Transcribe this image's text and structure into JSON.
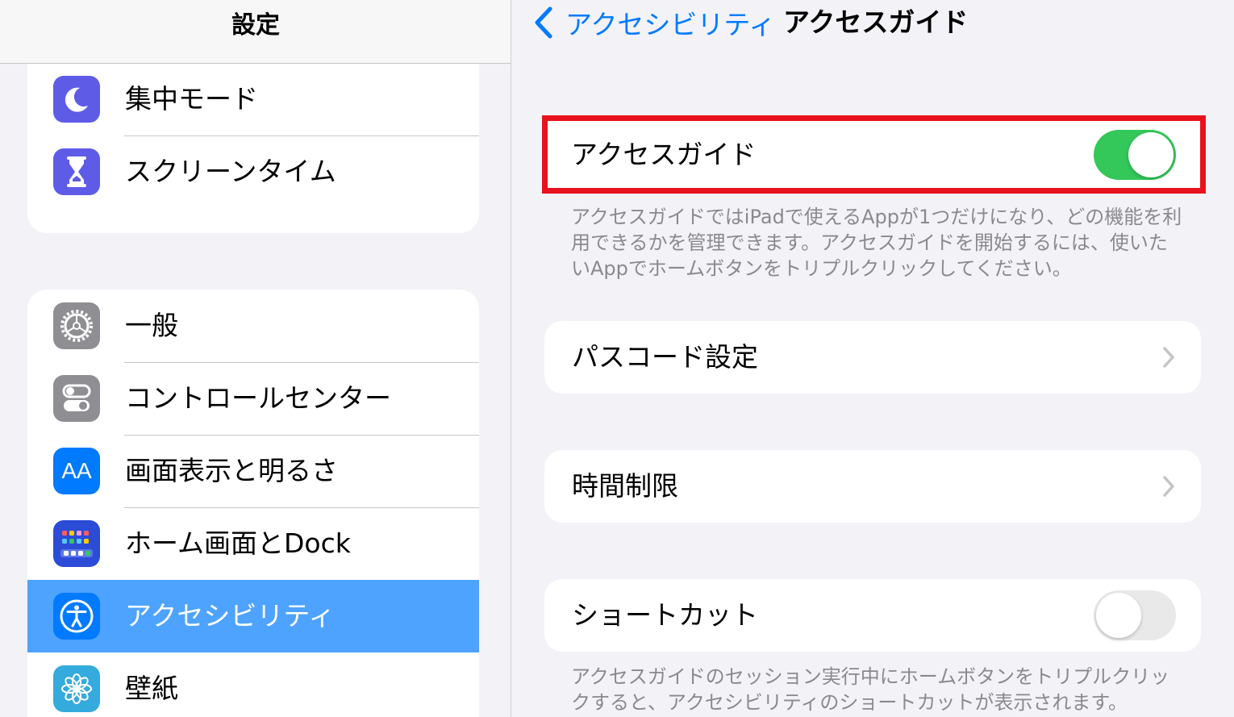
{
  "sidebar": {
    "title": "設定",
    "group1": [
      {
        "label": "集中モード",
        "icon": "moon-icon",
        "color": "#5e5ce6"
      },
      {
        "label": "スクリーンタイム",
        "icon": "hourglass-icon",
        "color": "#5e5ce6"
      }
    ],
    "group2": [
      {
        "label": "一般",
        "icon": "gear-icon",
        "color": "#8e8e93"
      },
      {
        "label": "コントロールセンター",
        "icon": "switches-icon",
        "color": "#8e8e93"
      },
      {
        "label": "画面表示と明るさ",
        "icon": "text-size-icon",
        "glyph": "AA",
        "color": "#007aff"
      },
      {
        "label": "ホーム画面とDock",
        "icon": "home-grid-icon",
        "color": "#2c4bd6"
      },
      {
        "label": "アクセシビリティ",
        "icon": "accessibility-icon",
        "color": "#007aff",
        "selected": true
      },
      {
        "label": "壁紙",
        "icon": "flower-icon",
        "color": "#35aadc"
      }
    ]
  },
  "nav": {
    "back_label": "アクセシビリティ",
    "title": "アクセスガイド"
  },
  "main": {
    "guided_access": {
      "label": "アクセスガイド",
      "enabled": true
    },
    "guided_access_footer": "アクセスガイドではiPadで使えるAppが1つだけになり、どの機能を利用できるかを管理できます。アクセスガイドを開始するには、使いたいAppでホームボタンをトリプルクリックしてください。",
    "passcode_settings": {
      "label": "パスコード設定"
    },
    "time_limits": {
      "label": "時間制限"
    },
    "shortcut": {
      "label": "ショートカット",
      "enabled": false
    },
    "shortcut_footer": "アクセスガイドのセッション実行中にホームボタンをトリプルクリックすると、アクセシビリティのショートカットが表示されます。"
  },
  "colors": {
    "accent": "#007aff",
    "toggle_on": "#34c759",
    "highlight_border": "#e8121f",
    "selected_row": "#4da3ff"
  }
}
